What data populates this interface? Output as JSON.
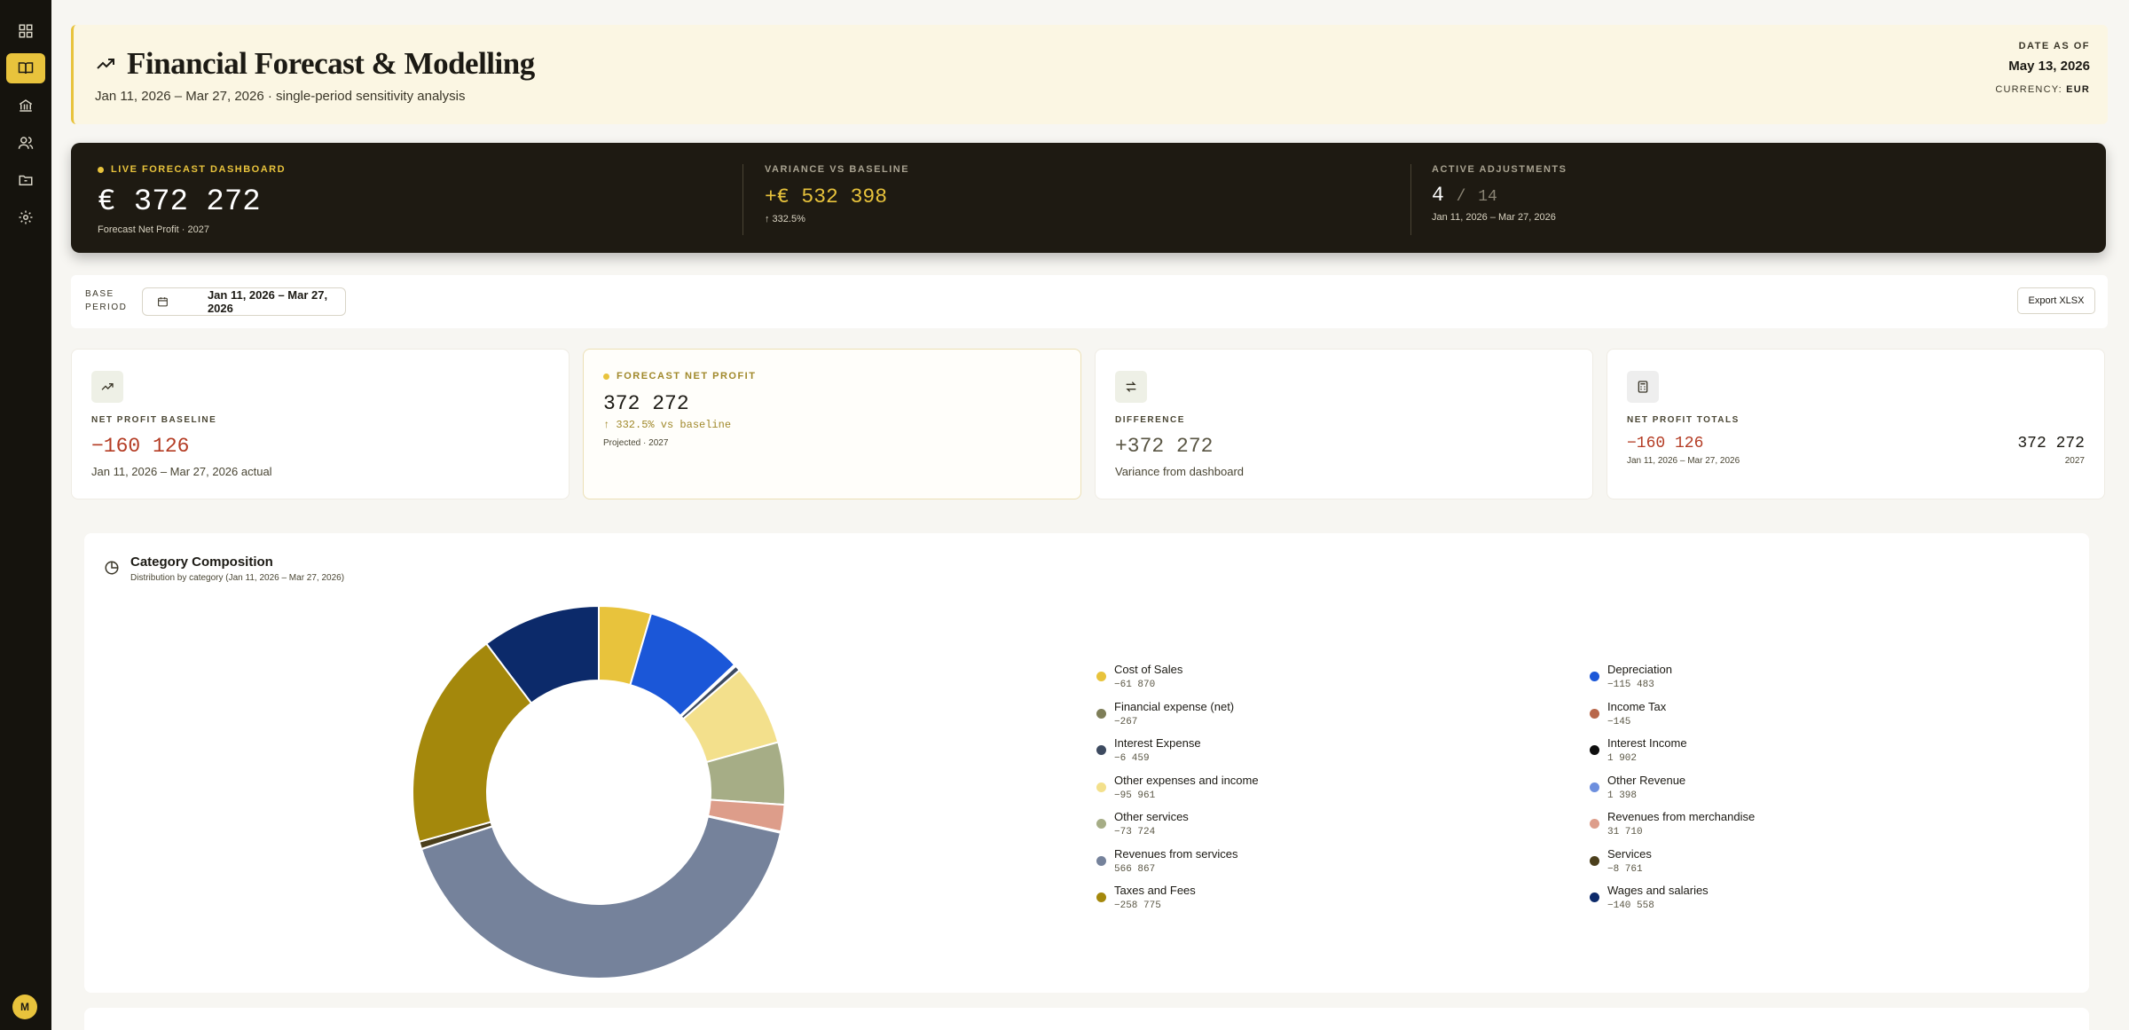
{
  "sidebar": {
    "items": [
      {
        "name": "grid-icon"
      },
      {
        "name": "book-icon"
      },
      {
        "name": "bank-icon"
      },
      {
        "name": "users-icon"
      },
      {
        "name": "folder-icon"
      },
      {
        "name": "gear-icon"
      }
    ],
    "active_index": 1,
    "avatar_initial": "M"
  },
  "header": {
    "title": "Financial Forecast & Modelling",
    "subtitle": "Jan 11, 2026 – Mar 27, 2026 · single-period sensitivity analysis",
    "date_label": "DATE AS OF",
    "date_value": "May 13, 2026",
    "currency_label": "CURRENCY:",
    "currency_value": "EUR"
  },
  "live": {
    "label": "LIVE FORECAST DASHBOARD",
    "value": "€ 372 272",
    "sub": "Forecast Net Profit · 2027",
    "variance_label": "VARIANCE VS BASELINE",
    "variance_value": "+€ 532 398",
    "variance_pct": "↑ 332.5%",
    "adjust_label": "ACTIVE ADJUSTMENTS",
    "adjust_count": "4",
    "adjust_sep": "/",
    "adjust_total": "14",
    "adjust_period": "Jan 11, 2026 – Mar 27, 2026"
  },
  "toolbar": {
    "base_label_1": "BASE",
    "base_label_2": "PERIOD",
    "period": "Jan 11, 2026 – Mar 27, 2026",
    "export_label": "Export XLSX"
  },
  "cards": {
    "baseline": {
      "label": "NET PROFIT BASELINE",
      "value": "−160 126",
      "sub": "Jan 11, 2026 – Mar 27, 2026 actual"
    },
    "forecast": {
      "label": "FORECAST NET PROFIT",
      "value": "372 272",
      "delta": "↑ 332.5% vs baseline",
      "sub": "Projected · 2027"
    },
    "difference": {
      "label": "DIFFERENCE",
      "value": "+372 272",
      "sub": "Variance from dashboard"
    },
    "totals": {
      "label": "NET PROFIT TOTALS",
      "left_value": "−160 126",
      "left_sub": "Jan 11, 2026 – Mar 27, 2026",
      "right_value": "372 272",
      "right_sub": "2027"
    }
  },
  "panel": {
    "title": "Category Composition",
    "subtitle": "Distribution by category (Jan 11, 2026 – Mar 27, 2026)"
  },
  "chart_data": {
    "type": "pie",
    "categories": [
      "Cost of Sales",
      "Depreciation",
      "Financial expense (net)",
      "Income Tax",
      "Interest Expense",
      "Interest Income",
      "Other expenses and income",
      "Other Revenue",
      "Other services",
      "Revenues from merchandise",
      "Revenues from services",
      "Services",
      "Taxes and Fees",
      "Wages and salaries"
    ],
    "labels": [
      "−61 870",
      "−115 483",
      "−267",
      "−145",
      "−6 459",
      "1 902",
      "−95 961",
      "1 398",
      "−73 724",
      "31 710",
      "566 867",
      "−8 761",
      "−258 775",
      "−140 558"
    ],
    "values": [
      -61870,
      -115483,
      -267,
      -145,
      -6459,
      1902,
      -95961,
      1398,
      -73724,
      31710,
      566867,
      -8761,
      -258775,
      -140558
    ],
    "colors": [
      "#e8c33c",
      "#1b57d8",
      "#7e7e58",
      "#b8674a",
      "#3d4a60",
      "#0e0e0e",
      "#f3e08c",
      "#6d8fde",
      "#a6ad86",
      "#dd9d8a",
      "#75829b",
      "#4b3f1c",
      "#a4880c",
      "#0c2a6a"
    ],
    "slice_order": [
      0,
      1,
      5,
      3,
      4,
      6,
      8,
      9,
      7,
      10,
      2,
      11,
      12,
      13
    ]
  }
}
